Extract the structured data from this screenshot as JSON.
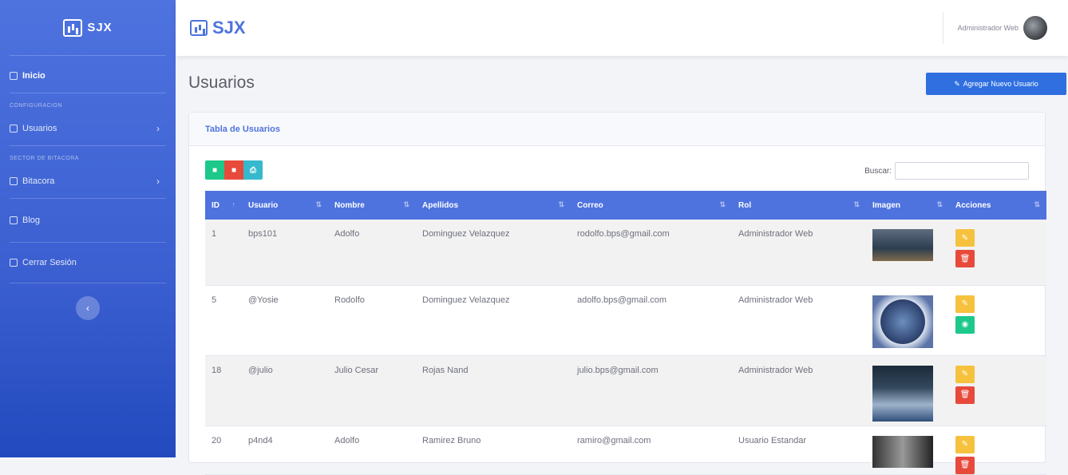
{
  "sidebar": {
    "brand": "SJX",
    "items": [
      {
        "label": "Inicio"
      },
      {
        "heading": "CONFIGURACION"
      },
      {
        "label": "Usuarios"
      },
      {
        "heading": "SECTOR DE BITACORA"
      },
      {
        "label": "Bitacora"
      },
      {
        "label": "Blog"
      },
      {
        "label": "Cerrar Sesión"
      }
    ],
    "toggle_glyph": "‹"
  },
  "topbar": {
    "brand": "SJX",
    "user_name": "Administrador Web"
  },
  "page": {
    "title": "Usuarios",
    "add_button": "Agregar Nuevo Usuario"
  },
  "card": {
    "title": "Tabla de Usuarios",
    "search_label": "Buscar:",
    "tools": [
      "csv",
      "pdf",
      "print"
    ]
  },
  "table": {
    "columns": [
      "ID",
      "Usuario",
      "Nombre",
      "Apellidos",
      "Correo",
      "Rol",
      "Imagen",
      "Acciones"
    ],
    "rows": [
      {
        "id": "1",
        "usuario": "bps101",
        "nombre": "Adolfo",
        "apellidos": "Dominguez Velazquez",
        "correo": "rodolfo.bps@gmail.com",
        "rol": "Administrador Web"
      },
      {
        "id": "5",
        "usuario": "@Yosie",
        "nombre": "Rodolfo",
        "apellidos": "Dominguez Velazquez",
        "correo": "adolfo.bps@gmail.com",
        "rol": "Administrador Web"
      },
      {
        "id": "18",
        "usuario": "@julio",
        "nombre": "Julio Cesar",
        "apellidos": "Rojas Nand",
        "correo": "julio.bps@gmail.com",
        "rol": "Administrador Web"
      },
      {
        "id": "20",
        "usuario": "p4nd4",
        "nombre": "Adolfo",
        "apellidos": "Ramirez Bruno",
        "correo": "ramiro@gmail.com",
        "rol": "Usuario Estandar"
      }
    ]
  },
  "colors": {
    "primary": "#4e73df",
    "success": "#1cc88a",
    "danger": "#e74a3b",
    "warning": "#f6c23e",
    "info": "#36b9cc"
  }
}
